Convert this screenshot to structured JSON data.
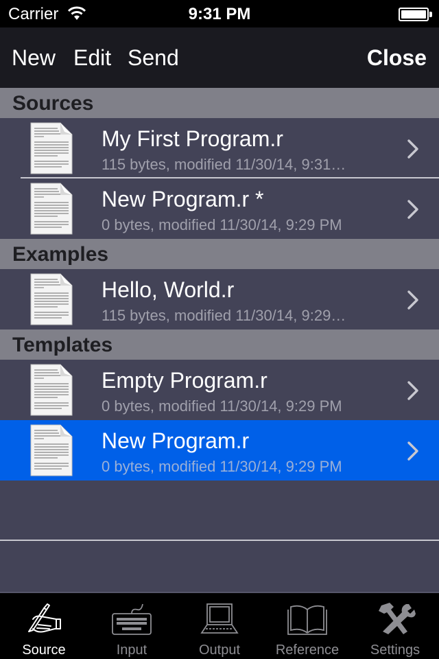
{
  "status_bar": {
    "carrier": "Carrier",
    "time": "9:31 PM",
    "wifi_icon": "wifi-icon",
    "battery_icon": "battery-icon",
    "battery_level": 1.0
  },
  "nav_bar": {
    "new_label": "New",
    "edit_label": "Edit",
    "send_label": "Send",
    "close_label": "Close"
  },
  "sections": [
    {
      "title": "Sources",
      "items": [
        {
          "icon": "document-icon",
          "title": "My First Program.r",
          "subtitle": "115 bytes, modified 11/30/14, 9:31…",
          "selected": false
        },
        {
          "icon": "document-icon",
          "title": "New Program.r *",
          "subtitle": "0 bytes, modified 11/30/14, 9:29 PM",
          "selected": false
        }
      ]
    },
    {
      "title": "Examples",
      "items": [
        {
          "icon": "document-icon",
          "title": "Hello, World.r",
          "subtitle": "115 bytes, modified 11/30/14, 9:29…",
          "selected": false
        }
      ]
    },
    {
      "title": "Templates",
      "items": [
        {
          "icon": "document-icon",
          "title": "Empty Program.r",
          "subtitle": "0 bytes, modified 11/30/14, 9:29 PM",
          "selected": false
        },
        {
          "icon": "document-icon",
          "title": "New Program.r",
          "subtitle": "0 bytes, modified 11/30/14, 9:29 PM",
          "selected": true
        }
      ]
    }
  ],
  "tab_bar": {
    "tabs": [
      {
        "label": "Source",
        "icon": "pen-hand-icon",
        "active": true
      },
      {
        "label": "Input",
        "icon": "keyboard-icon",
        "active": false
      },
      {
        "label": "Output",
        "icon": "computer-icon",
        "active": false
      },
      {
        "label": "Reference",
        "icon": "book-icon",
        "active": false
      },
      {
        "label": "Settings",
        "icon": "tools-icon",
        "active": false
      }
    ]
  },
  "colors": {
    "nav_background": "#1a1a20",
    "list_background": "#434357",
    "section_header_background": "#808089",
    "selection": "#0060e8",
    "tab_inactive": "#8e8e93",
    "tab_active": "#ffffff"
  }
}
